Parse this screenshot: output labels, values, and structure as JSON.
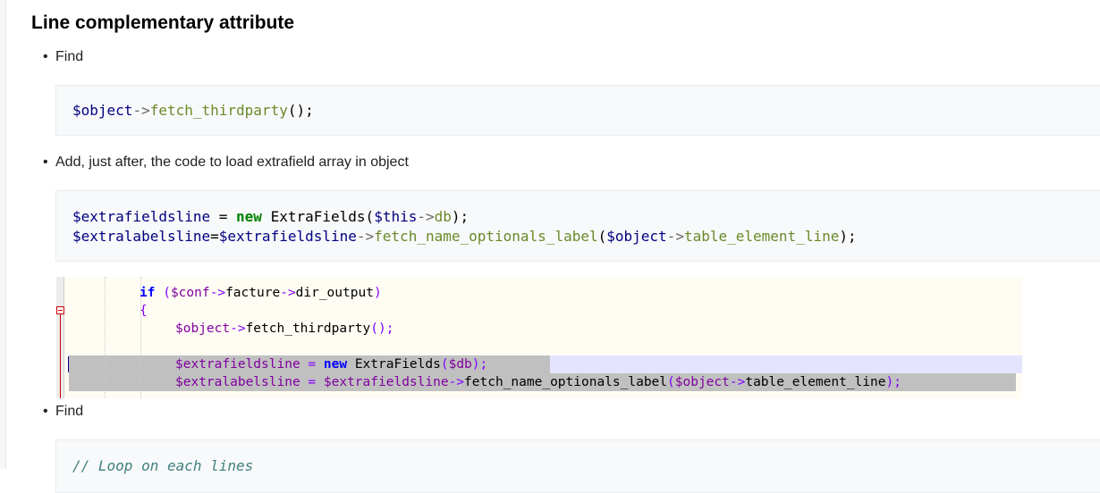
{
  "section": {
    "title": "Line complementary attribute"
  },
  "steps": [
    {
      "label": "Find"
    },
    {
      "label": "Add, just after, the code to load extrafield array in object"
    },
    {
      "label": "Find"
    }
  ],
  "code_blocks": [
    {
      "lines": [
        "$object->fetch_thirdparty();"
      ]
    },
    {
      "lines": [
        "$extrafieldsline = new ExtraFields($this->db);",
        "$extralabelsline=$extrafieldsline->fetch_name_optionals_label($object->table_element_line);"
      ]
    },
    {
      "lines": [
        "// Loop on each lines"
      ]
    }
  ],
  "editor": {
    "lines": [
      "if ($conf->facture->dir_output)",
      "{",
      "$object->fetch_thirdparty();",
      "",
      "$extrafieldsline = new ExtraFields($db);",
      "$extralabelsline = $extrafieldsline->fetch_name_optionals_label($object->table_element_line);"
    ]
  }
}
